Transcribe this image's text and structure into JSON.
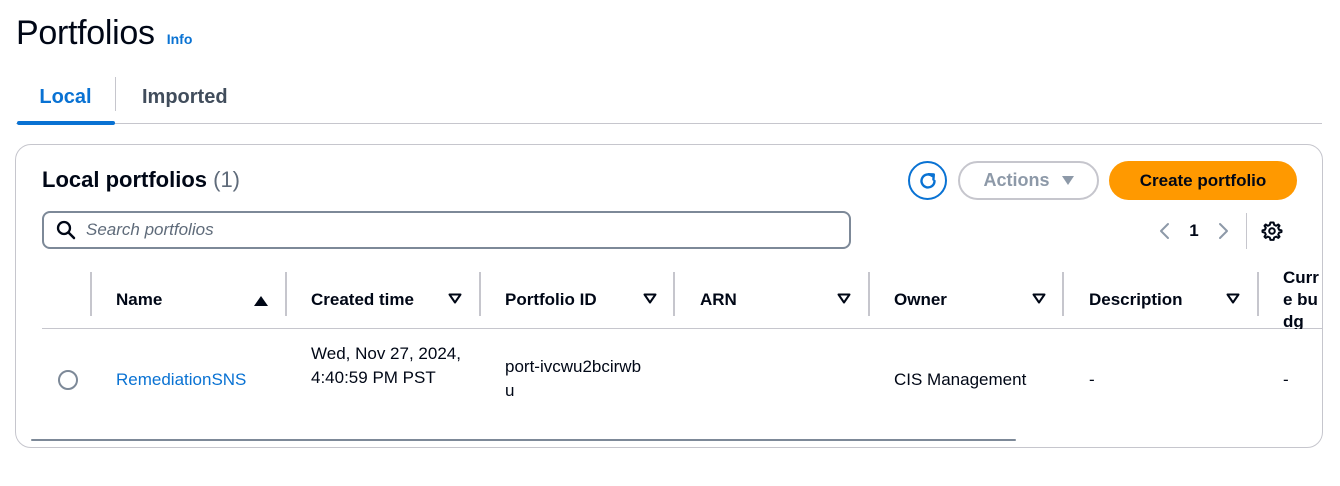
{
  "page": {
    "title": "Portfolios",
    "info_label": "Info"
  },
  "tabs": [
    {
      "label": "Local",
      "active": true
    },
    {
      "label": "Imported",
      "active": false
    }
  ],
  "container": {
    "title": "Local portfolios",
    "count": "(1)",
    "actions_label": "Actions",
    "create_label": "Create portfolio"
  },
  "search": {
    "placeholder": "Search portfolios",
    "value": ""
  },
  "pagination": {
    "current_page": "1"
  },
  "table": {
    "columns": [
      "Name",
      "Created time",
      "Portfolio ID",
      "ARN",
      "Owner",
      "Description",
      "Curre budg"
    ],
    "rows": [
      {
        "name": "RemediationSNS",
        "created_time": "Wed, Nov 27, 2024, 4:40:59 PM PST",
        "portfolio_id": "port-ivcwu2bcirwbu",
        "arn": "",
        "owner": "CIS Management",
        "description": "-",
        "current_budget": "-"
      }
    ]
  },
  "colors": {
    "accent": "#0972d3",
    "primary_button": "#ff9900",
    "border": "#c6c6cd"
  },
  "icons": [
    "refresh-icon",
    "caret-down-icon",
    "search-icon",
    "chevron-left-icon",
    "chevron-right-icon",
    "gear-icon",
    "sort-ascending-icon",
    "sort-descending-icon"
  ]
}
